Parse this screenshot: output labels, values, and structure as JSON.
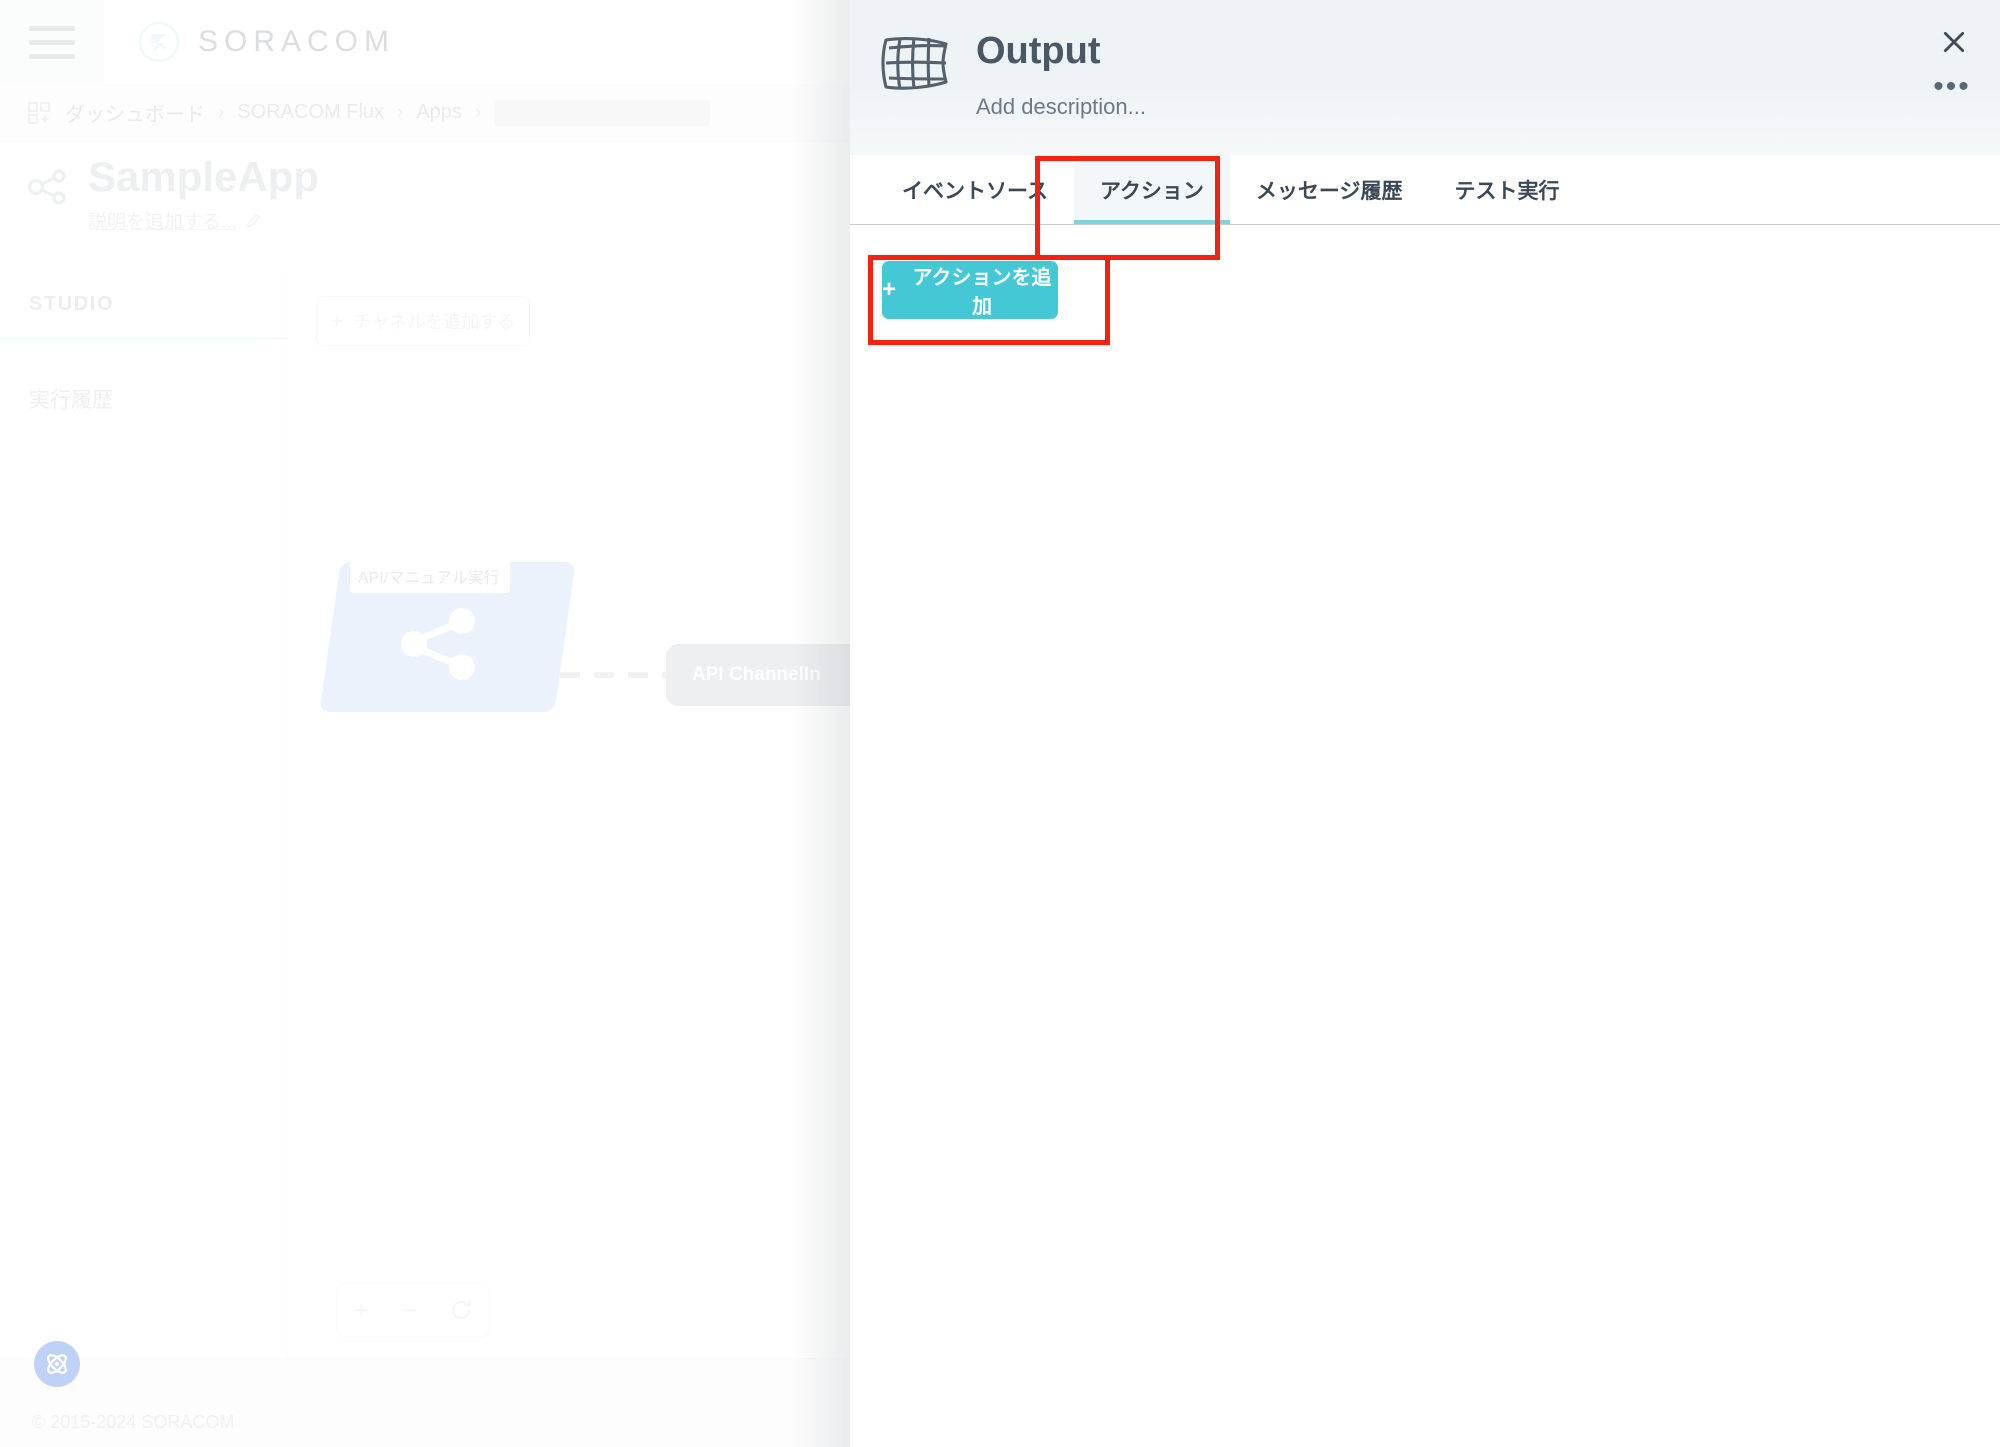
{
  "background_app": {
    "header": {
      "menu_icon": "hamburger-menu-icon",
      "logo_icon": "soracom-logo-icon",
      "logo_text": "SORACOM"
    },
    "breadcrumb": {
      "grid_icon": "dashboard-grid-icon",
      "items": [
        "ダッシュボード",
        "SORACOM Flux",
        "Apps"
      ],
      "separator": "›",
      "loading_placeholder": ""
    },
    "app_title": {
      "icon": "flux-share-icon",
      "name": "SampleApp",
      "description_placeholder": "説明を追加する...",
      "edit_icon": "pencil-icon"
    },
    "sidebar": {
      "tab_label": "STUDIO",
      "items": [
        {
          "label": "実行履歴"
        }
      ]
    },
    "canvas": {
      "add_channel_label": "チャネルを追加する",
      "add_channel_plus": "+",
      "node": {
        "label": "API/マニュアル実行",
        "icon": "share-nodes-icon"
      },
      "edge_style": "dashed",
      "channel_pill": "API ChannelIn",
      "zoom_controls": {
        "zoom_in": "+",
        "zoom_out": "−",
        "reset_icon": "reset-zoom-icon"
      }
    },
    "footer": {
      "copyright": "© 2015-2024 SORACOM",
      "support_icon": "support-atom-icon"
    }
  },
  "panel": {
    "icon": "flux-output-mesh-icon",
    "title": "Output",
    "description_placeholder": "Add description...",
    "close_icon": "close-icon",
    "more_icon": "more-horizontal-icon",
    "tabs": [
      {
        "label": "イベントソース",
        "active": false
      },
      {
        "label": "アクション",
        "active": true
      },
      {
        "label": "メッセージ履歴",
        "active": false
      },
      {
        "label": "テスト実行",
        "active": false
      }
    ],
    "add_action_button": {
      "plus": "+",
      "label": "アクションを追加"
    }
  },
  "annotations": {
    "color": "#f42213",
    "targets": [
      "アクション",
      "アクションを追加"
    ]
  },
  "colors": {
    "accent_teal": "#45c8d6",
    "tab_underline": "#7fd3e0",
    "panel_header_bg": "#eef4f6",
    "panel_title": "#4a5866",
    "annotation_red": "#f42213",
    "node_blue": "#c3d6f6",
    "pill_gray": "#c9ccd2",
    "support_blue": "#2f6ae8"
  }
}
